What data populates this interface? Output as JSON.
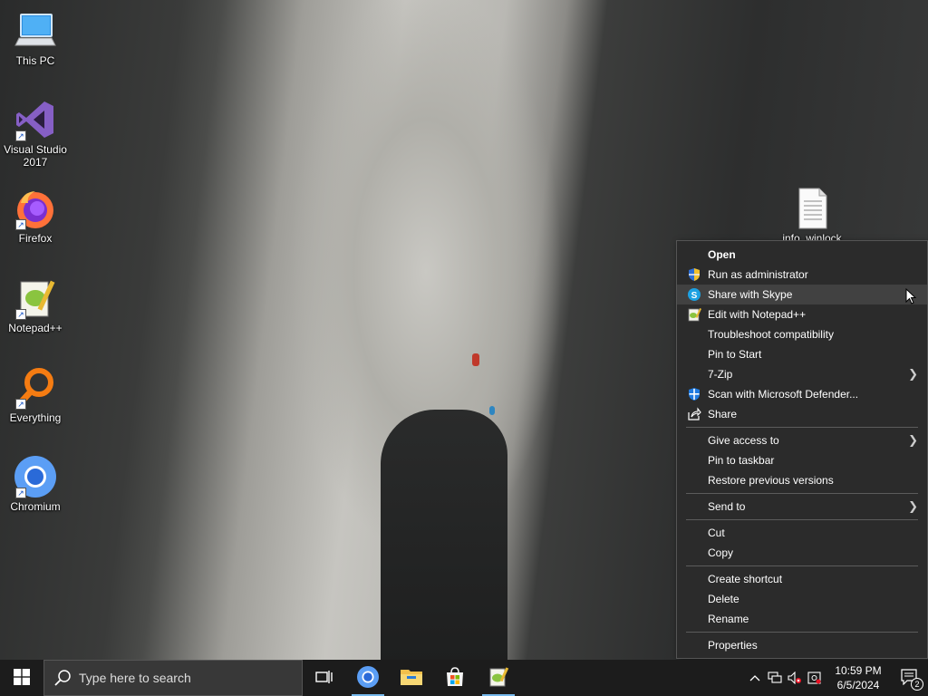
{
  "desktop": {
    "icons": [
      {
        "label": "This PC"
      },
      {
        "label": "Visual Studio 2017"
      },
      {
        "label": "Firefox"
      },
      {
        "label": "Notepad++"
      },
      {
        "label": "Everything"
      },
      {
        "label": "Chromium"
      }
    ],
    "file": {
      "label": "info_winlock"
    }
  },
  "context_menu": {
    "items": [
      {
        "label": "Open",
        "icon": "none",
        "bold": true
      },
      {
        "label": "Run as administrator",
        "icon": "uac-shield-icon"
      },
      {
        "label": "Share with Skype",
        "icon": "skype-icon",
        "hover": true
      },
      {
        "label": "Edit with Notepad++",
        "icon": "notepadpp-icon"
      },
      {
        "label": "Troubleshoot compatibility",
        "icon": "none"
      },
      {
        "label": "Pin to Start",
        "icon": "none"
      },
      {
        "label": "7-Zip",
        "icon": "none",
        "submenu": true
      },
      {
        "label": "Scan with Microsoft Defender...",
        "icon": "defender-icon"
      },
      {
        "label": "Share",
        "icon": "share-icon"
      },
      {
        "label": "Give access to",
        "submenu": true
      },
      {
        "label": "Pin to taskbar"
      },
      {
        "label": "Restore previous versions"
      },
      {
        "label": "Send to",
        "submenu": true
      },
      {
        "label": "Cut"
      },
      {
        "label": "Copy"
      },
      {
        "label": "Create shortcut"
      },
      {
        "label": "Delete"
      },
      {
        "label": "Rename"
      },
      {
        "label": "Properties"
      }
    ]
  },
  "taskbar": {
    "search_placeholder": "Type here to search",
    "clock_time": "10:59 PM",
    "clock_date": "6/5/2024",
    "notification_count": "2"
  },
  "colors": {
    "menu_bg": "#2b2b2b",
    "menu_hover": "#414141",
    "taskbar_bg": "#1c1c1c",
    "accent": "#76b9ed"
  }
}
